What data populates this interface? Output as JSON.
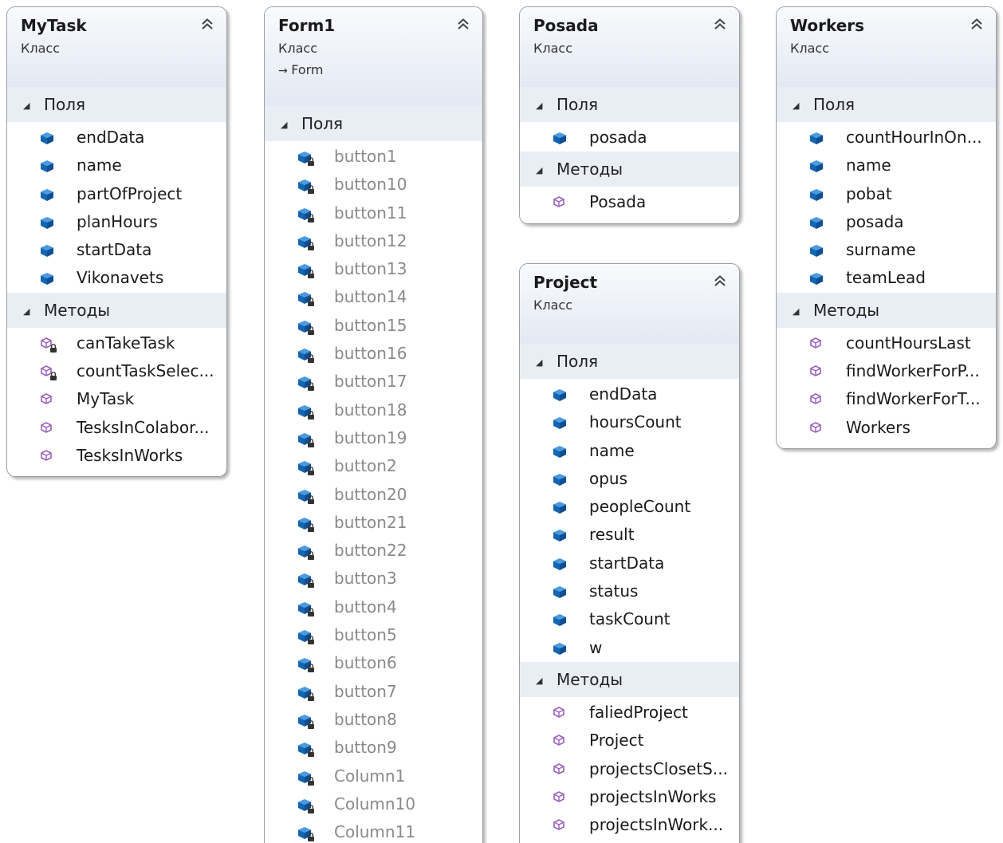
{
  "classes": [
    {
      "id": "mytask",
      "name": "MyTask",
      "kind": "Класс",
      "base": null,
      "sections": [
        {
          "title": "Поля",
          "members": [
            {
              "name": "endData",
              "icon": "field-icon",
              "private": false
            },
            {
              "name": "name",
              "icon": "field-icon",
              "private": false
            },
            {
              "name": "partOfProject",
              "icon": "field-icon",
              "private": false
            },
            {
              "name": "planHours",
              "icon": "field-icon",
              "private": false
            },
            {
              "name": "startData",
              "icon": "field-icon",
              "private": false
            },
            {
              "name": "Vikonavets",
              "icon": "field-icon",
              "private": false
            }
          ]
        },
        {
          "title": "Методы",
          "members": [
            {
              "name": "canTakeTask",
              "icon": "private-method-icon",
              "private": false
            },
            {
              "name": "countTaskSelec...",
              "icon": "private-method-icon",
              "private": false
            },
            {
              "name": "MyTask",
              "icon": "method-icon",
              "private": false
            },
            {
              "name": "TesksInColabor...",
              "icon": "method-icon",
              "private": false
            },
            {
              "name": "TesksInWorks",
              "icon": "method-icon",
              "private": false
            }
          ]
        }
      ]
    },
    {
      "id": "form1",
      "name": "Form1",
      "kind": "Класс",
      "base": "Form",
      "sections": [
        {
          "title": "Поля",
          "members": [
            {
              "name": "button1",
              "icon": "private-field-icon",
              "private": true
            },
            {
              "name": "button10",
              "icon": "private-field-icon",
              "private": true
            },
            {
              "name": "button11",
              "icon": "private-field-icon",
              "private": true
            },
            {
              "name": "button12",
              "icon": "private-field-icon",
              "private": true
            },
            {
              "name": "button13",
              "icon": "private-field-icon",
              "private": true
            },
            {
              "name": "button14",
              "icon": "private-field-icon",
              "private": true
            },
            {
              "name": "button15",
              "icon": "private-field-icon",
              "private": true
            },
            {
              "name": "button16",
              "icon": "private-field-icon",
              "private": true
            },
            {
              "name": "button17",
              "icon": "private-field-icon",
              "private": true
            },
            {
              "name": "button18",
              "icon": "private-field-icon",
              "private": true
            },
            {
              "name": "button19",
              "icon": "private-field-icon",
              "private": true
            },
            {
              "name": "button2",
              "icon": "private-field-icon",
              "private": true
            },
            {
              "name": "button20",
              "icon": "private-field-icon",
              "private": true
            },
            {
              "name": "button21",
              "icon": "private-field-icon",
              "private": true
            },
            {
              "name": "button22",
              "icon": "private-field-icon",
              "private": true
            },
            {
              "name": "button3",
              "icon": "private-field-icon",
              "private": true
            },
            {
              "name": "button4",
              "icon": "private-field-icon",
              "private": true
            },
            {
              "name": "button5",
              "icon": "private-field-icon",
              "private": true
            },
            {
              "name": "button6",
              "icon": "private-field-icon",
              "private": true
            },
            {
              "name": "button7",
              "icon": "private-field-icon",
              "private": true
            },
            {
              "name": "button8",
              "icon": "private-field-icon",
              "private": true
            },
            {
              "name": "button9",
              "icon": "private-field-icon",
              "private": true
            },
            {
              "name": "Column1",
              "icon": "private-field-icon",
              "private": true
            },
            {
              "name": "Column10",
              "icon": "private-field-icon",
              "private": true
            },
            {
              "name": "Column11",
              "icon": "private-field-icon",
              "private": true
            }
          ]
        }
      ]
    },
    {
      "id": "posada",
      "name": "Posada",
      "kind": "Класс",
      "base": null,
      "sections": [
        {
          "title": "Поля",
          "members": [
            {
              "name": "posada",
              "icon": "field-icon",
              "private": false
            }
          ]
        },
        {
          "title": "Методы",
          "members": [
            {
              "name": "Posada",
              "icon": "method-icon",
              "private": false
            }
          ]
        }
      ]
    },
    {
      "id": "project",
      "name": "Project",
      "kind": "Класс",
      "base": null,
      "sections": [
        {
          "title": "Поля",
          "members": [
            {
              "name": "endData",
              "icon": "field-icon",
              "private": false
            },
            {
              "name": "hoursCount",
              "icon": "field-icon",
              "private": false
            },
            {
              "name": "name",
              "icon": "field-icon",
              "private": false
            },
            {
              "name": "opus",
              "icon": "field-icon",
              "private": false
            },
            {
              "name": "peopleCount",
              "icon": "field-icon",
              "private": false
            },
            {
              "name": "result",
              "icon": "field-icon",
              "private": false
            },
            {
              "name": "startData",
              "icon": "field-icon",
              "private": false
            },
            {
              "name": "status",
              "icon": "field-icon",
              "private": false
            },
            {
              "name": "taskCount",
              "icon": "field-icon",
              "private": false
            },
            {
              "name": "w",
              "icon": "field-icon",
              "private": false
            }
          ]
        },
        {
          "title": "Методы",
          "members": [
            {
              "name": "faliedProject",
              "icon": "method-icon",
              "private": false
            },
            {
              "name": "Project",
              "icon": "method-icon",
              "private": false
            },
            {
              "name": "projectsClosetS...",
              "icon": "method-icon",
              "private": false
            },
            {
              "name": "projectsInWorks",
              "icon": "method-icon",
              "private": false
            },
            {
              "name": "projectsInWork...",
              "icon": "method-icon",
              "private": false
            }
          ]
        }
      ]
    },
    {
      "id": "workers",
      "name": "Workers",
      "kind": "Класс",
      "base": null,
      "sections": [
        {
          "title": "Поля",
          "members": [
            {
              "name": "countHourInOn...",
              "icon": "field-icon",
              "private": false
            },
            {
              "name": "name",
              "icon": "field-icon",
              "private": false
            },
            {
              "name": "pobat",
              "icon": "field-icon",
              "private": false
            },
            {
              "name": "posada",
              "icon": "field-icon",
              "private": false
            },
            {
              "name": "surname",
              "icon": "field-icon",
              "private": false
            },
            {
              "name": "teamLead",
              "icon": "field-icon",
              "private": false
            }
          ]
        },
        {
          "title": "Методы",
          "members": [
            {
              "name": "countHoursLast",
              "icon": "method-icon",
              "private": false
            },
            {
              "name": "findWorkerForP...",
              "icon": "method-icon",
              "private": false
            },
            {
              "name": "findWorkerForT...",
              "icon": "method-icon",
              "private": false
            },
            {
              "name": "Workers",
              "icon": "method-icon",
              "private": false
            }
          ]
        }
      ]
    }
  ],
  "colors": {
    "field_icon": "#1565b0",
    "field_icon_top": "#4a9ae0",
    "method_icon": "#9b5fc0",
    "lock": "#333333",
    "private_text": "#8a8a8a",
    "section_bg": "#e9edf4",
    "header_bg_top": "#f9fafd",
    "header_bg_bottom": "#e3e9f3"
  }
}
